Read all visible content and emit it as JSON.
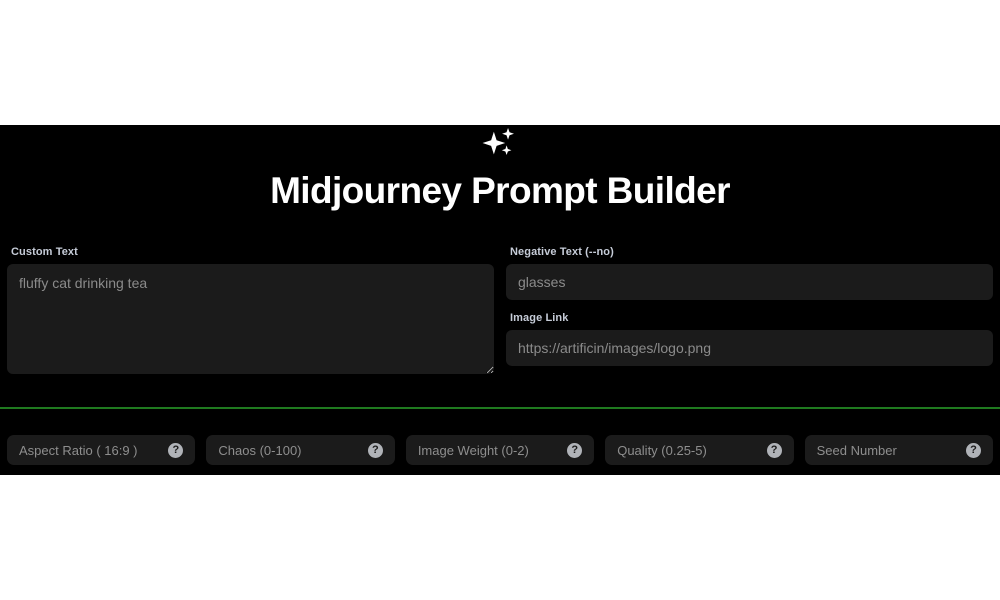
{
  "app": {
    "title": "Midjourney Prompt Builder",
    "sparkle_icon": "sparkles-icon",
    "panel_bg": "#000000",
    "page_bg": "#ffffff",
    "divider_color": "#1f7a1f",
    "field_bg": "#1b1b1b",
    "label_color": "#c6ccd8"
  },
  "form": {
    "left": {
      "custom_text": {
        "label": "Custom Text",
        "placeholder": "fluffy cat drinking tea",
        "value": ""
      }
    },
    "right": {
      "negative_text": {
        "label": "Negative Text (--no)",
        "placeholder": "glasses",
        "value": ""
      },
      "image_link": {
        "label": "Image Link",
        "placeholder": "https://artificin/images/logo.png",
        "value": ""
      }
    }
  },
  "params": [
    {
      "name": "aspect-ratio",
      "placeholder": "Aspect Ratio ( 16:9 )",
      "value": "",
      "help_icon": "help-icon",
      "help_glyph": "?"
    },
    {
      "name": "chaos",
      "placeholder": "Chaos (0-100)",
      "value": "",
      "help_icon": "help-icon",
      "help_glyph": "?"
    },
    {
      "name": "image-weight",
      "placeholder": "Image Weight (0-2)",
      "value": "",
      "help_icon": "help-icon",
      "help_glyph": "?"
    },
    {
      "name": "quality",
      "placeholder": "Quality (0.25-5)",
      "value": "",
      "help_icon": "help-icon",
      "help_glyph": "?"
    },
    {
      "name": "seed-number",
      "placeholder": "Seed Number",
      "value": "",
      "help_icon": "help-icon",
      "help_glyph": "?"
    }
  ]
}
